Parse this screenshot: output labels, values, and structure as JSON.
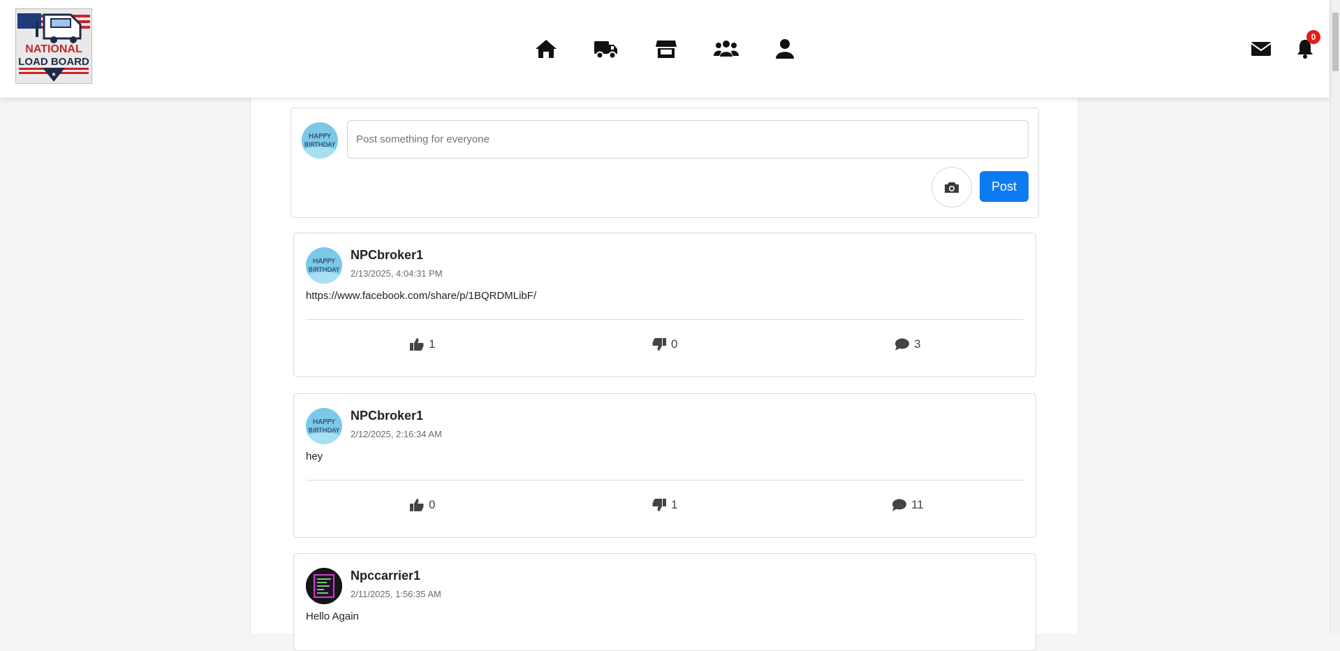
{
  "header": {
    "logo_text_top": "NATIONAL",
    "logo_text_bottom": "LOAD BOARD",
    "nav_icons": [
      "home-icon",
      "truck-icon",
      "store-icon",
      "users-icon",
      "user-icon"
    ],
    "notification_count": "0"
  },
  "composer": {
    "placeholder": "Post something for everyone",
    "post_label": "Post"
  },
  "posts": [
    {
      "author": "NPCbroker1",
      "timestamp": "2/13/2025, 4:04:31 PM",
      "text": "https://www.facebook.com/share/p/1BQRDMLibF/",
      "likes": "1",
      "dislikes": "0",
      "comments": "3",
      "avatar": "happy-birthday"
    },
    {
      "author": "NPCbroker1",
      "timestamp": "2/12/2025, 2:16:34 AM",
      "text": "hey",
      "likes": "0",
      "dislikes": "1",
      "comments": "11",
      "avatar": "happy-birthday"
    },
    {
      "author": "Npccarrier1",
      "timestamp": "2/11/2025, 1:56:35 AM",
      "text": "Hello Again",
      "avatar": "terminal-screen"
    }
  ],
  "colors": {
    "primary": "#0d7bf0",
    "badge": "#e41b1b",
    "avatar_bg": "#7cc8e8"
  }
}
